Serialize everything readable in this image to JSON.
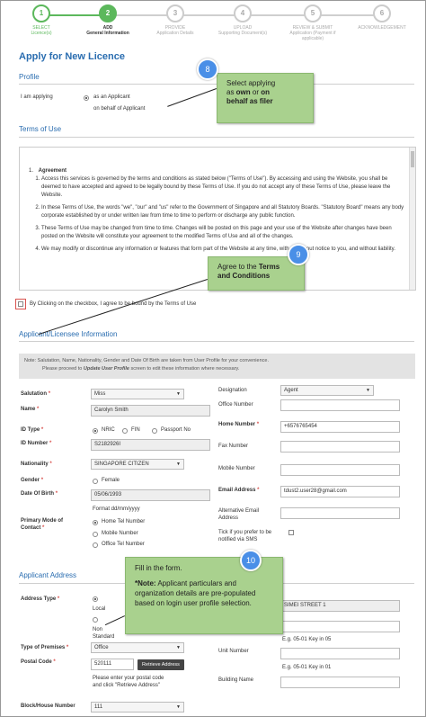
{
  "stepper": [
    {
      "num": "1",
      "label": "SELECT",
      "sub": "Licence(s)",
      "state": "done"
    },
    {
      "num": "2",
      "label": "ADD",
      "sub": "General Information",
      "state": "active"
    },
    {
      "num": "3",
      "label": "PROVIDE",
      "sub": "Application Details",
      "state": "todo"
    },
    {
      "num": "4",
      "label": "UPLOAD",
      "sub": "Supporting Document(s)",
      "state": "todo"
    },
    {
      "num": "5",
      "label": "REVIEW & SUBMIT",
      "sub": "Application (Payment if applicable)",
      "state": "todo"
    },
    {
      "num": "6",
      "label": "ACKNOWLEDGEMENT",
      "sub": "",
      "state": "todo"
    }
  ],
  "page_title": "Apply for New Licence",
  "profile": {
    "heading": "Profile",
    "i_am_applying": "I am applying",
    "opt_applicant": "as an Applicant",
    "opt_behalf": "on behalf of Applicant"
  },
  "terms": {
    "heading": "Terms of Use",
    "item1_title": "Agreement",
    "items": [
      "Access this services is governed by the terms and conditions as stated below (\"Terms of Use\"). By accessing and using the Website, you shall be deemed to have accepted and agreed to be legally bound by these Terms of Use. If you do not accept any of these Terms of Use, please leave the Website.",
      "In these Terms of Use, the words \"we\", \"our\" and \"us\" refer to the Government of Singapore and all Statutory Boards. \"Statutory Board\" means any body corporate established by or under written law from time to time to perform or discharge any public function.",
      "These Terms of Use may be changed from time to time. Changes will be posted on this page and your use of the Website after changes have been posted on the Website will constitute your agreement to the modified Terms of Use and all of the changes.",
      "We may modify or discontinue any information or features that form part of the Website at any time, with or without notice to you, and without liability."
    ],
    "agree_label": "By Clicking on the checkbox, I agree to be bound by the Terms of Use"
  },
  "applicant": {
    "heading": "Applicant/Licensee Information",
    "note_line1": "Note: Salutation, Name, Nationality, Gender and Date Of Birth are taken from User Profile for your convenience.",
    "note_line2_pre": "Please proceed to ",
    "note_line2_em": "Update User Profile",
    "note_line2_post": " screen to edit these information where necessary.",
    "salutation_label": "Salutation",
    "salutation_value": "Miss",
    "name_label": "Name",
    "name_value": "Carolyn Smith",
    "idtype_label": "ID Type",
    "idtype_options": [
      "NRIC",
      "FIN",
      "Passport No"
    ],
    "idnumber_label": "ID Number",
    "idnumber_value": "S2182926I",
    "nationality_label": "Nationality",
    "nationality_value": "SINGAPORE CITIZEN",
    "gender_label": "Gender",
    "gender_value": "Female",
    "dob_label": "Date Of Birth",
    "dob_value": "05/06/1993",
    "dob_format": "Format  dd/mm/yyyy",
    "contact_label": "Primary Mode of Contact",
    "contact_options": [
      "Home Tel Number",
      "Mobile Number",
      "Office Tel Number"
    ],
    "designation_label": "Designation",
    "designation_value": "Agent",
    "office_label": "Office Number",
    "home_label": "Home Number",
    "home_value": "+6576765454",
    "fax_label": "Fax Number",
    "mobile_label": "Mobile Number",
    "email_label": "Email Address",
    "email_value": "tdust2.user28@gmail.com",
    "alt_email_label": "Alternative Email Address",
    "sms_label": "Tick if you prefer to be notified via SMS"
  },
  "address": {
    "heading": "Applicant Address",
    "type_label": "Address Type",
    "type_local": "Local",
    "type_nonstd": "Non Standard",
    "street_value": "SIMEI STREET 1",
    "unit_hint1": "E.g. 05-01 Key in 05",
    "premises_label": "Type of Premises",
    "premises_value": "Office",
    "postal_label": "Postal Code",
    "postal_value": "520111",
    "retrieve_btn": "Retrieve Address",
    "postal_hint": "Please enter your postal code and click \"Retrieve Address\"",
    "unit_label": "Unit Number",
    "unit_hint2": "E.g. 05-01 Key in 01",
    "building_label": "Building Name",
    "block_label": "Block/House Number",
    "block_value": "111"
  },
  "callouts": {
    "c8_num": "8",
    "c8_line1": "Select applying",
    "c8_line2a": "as ",
    "c8_line2b": "own",
    "c8_line2c": " or ",
    "c8_line2d": "on",
    "c8_line3": "behalf as filer",
    "c9_num": "9",
    "c9_line1a": "Agree to the ",
    "c9_line1b": "Terms",
    "c9_line2": "and Conditions",
    "c10_num": "10",
    "c10_line1": "Fill in the form.",
    "c10_note": "*Note:",
    "c10_rest": " Applicant particulars and organization details are pre-populated based on login user profile selection."
  }
}
